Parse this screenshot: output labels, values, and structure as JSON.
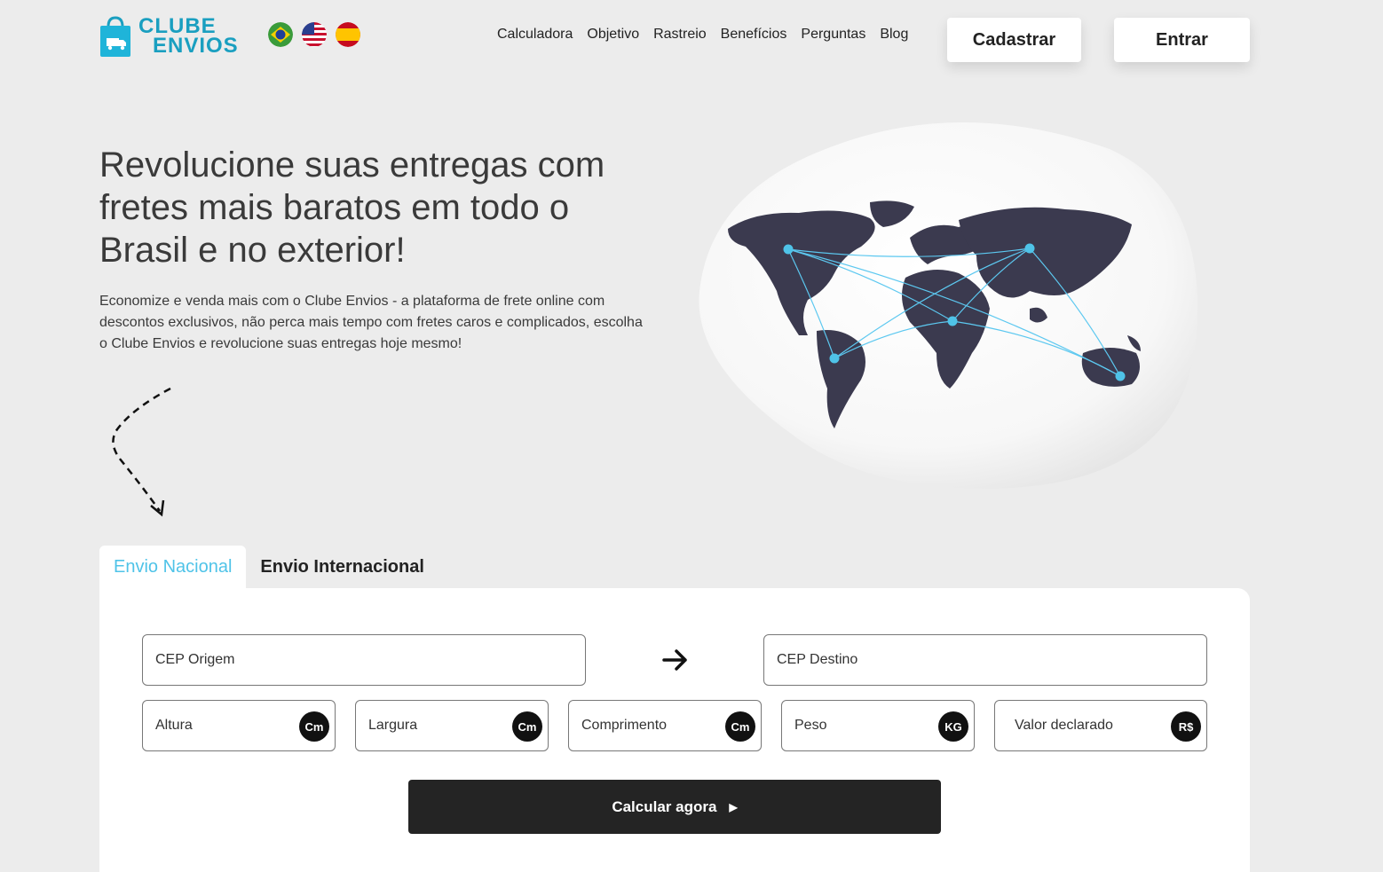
{
  "brand": {
    "line1": "CLUBE",
    "line2": "ENVIOS",
    "color": "#1a9fc0"
  },
  "languages": [
    {
      "name": "Português",
      "icon": "brazil-flag-icon"
    },
    {
      "name": "English",
      "icon": "usa-flag-icon"
    },
    {
      "name": "Español",
      "icon": "spain-flag-icon"
    }
  ],
  "nav": [
    "Calculadora",
    "Objetivo",
    "Rastreio",
    "Benefícios",
    "Perguntas",
    "Blog"
  ],
  "actions": {
    "signup": "Cadastrar",
    "login": "Entrar"
  },
  "hero": {
    "title": "Revolucione suas entregas com fretes mais baratos em todo o Brasil e no exterior!",
    "description": "Economize e venda mais com o Clube Envios - a plataforma de frete online com descontos exclusivos, não perca mais tempo com fretes caros e complicados, escolha o Clube Envios e revolucione suas entregas hoje mesmo!"
  },
  "tabs": {
    "national": "Envio Nacional",
    "international": "Envio Internacional",
    "active": "national"
  },
  "form": {
    "origin_placeholder": "CEP Origem",
    "destination_placeholder": "CEP Destino",
    "height_placeholder": "Altura",
    "width_placeholder": "Largura",
    "length_placeholder": "Comprimento",
    "weight_placeholder": "Peso",
    "declared_value_placeholder": "Valor declarado",
    "unit_cm": "Cm",
    "unit_kg": "KG",
    "unit_brl": "R$",
    "submit": "Calcular agora"
  },
  "colors": {
    "accent": "#4fc3e8",
    "dark": "#242424",
    "background": "#ececec"
  }
}
